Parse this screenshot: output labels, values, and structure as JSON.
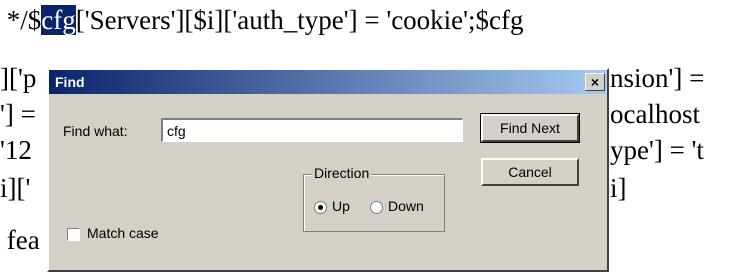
{
  "editor": {
    "lines": [
      {
        "before": " */$",
        "highlight": "cfg",
        "after": "['Servers'][$i]['auth_type'] = 'cookie';$cfg"
      },
      {
        "text": "]['p",
        "right": "nsion'] ="
      },
      {
        "text": "'] =",
        "right": "ocalhost"
      },
      {
        "text": "'12",
        "right": "ype'] = 't"
      },
      {
        "text": "i]['",
        "right": "i]"
      },
      {
        "text": " fea",
        "right": ""
      }
    ]
  },
  "dialog": {
    "title": "Find",
    "close_label": "×",
    "find_what_label": "Find what:",
    "find_value": "cfg",
    "find_next_label": "Find Next",
    "cancel_label": "Cancel",
    "direction_label": "Direction",
    "up_label": "Up",
    "down_label": "Down",
    "direction_selected": "Up",
    "match_case_label": "Match case",
    "match_case_checked": false
  }
}
